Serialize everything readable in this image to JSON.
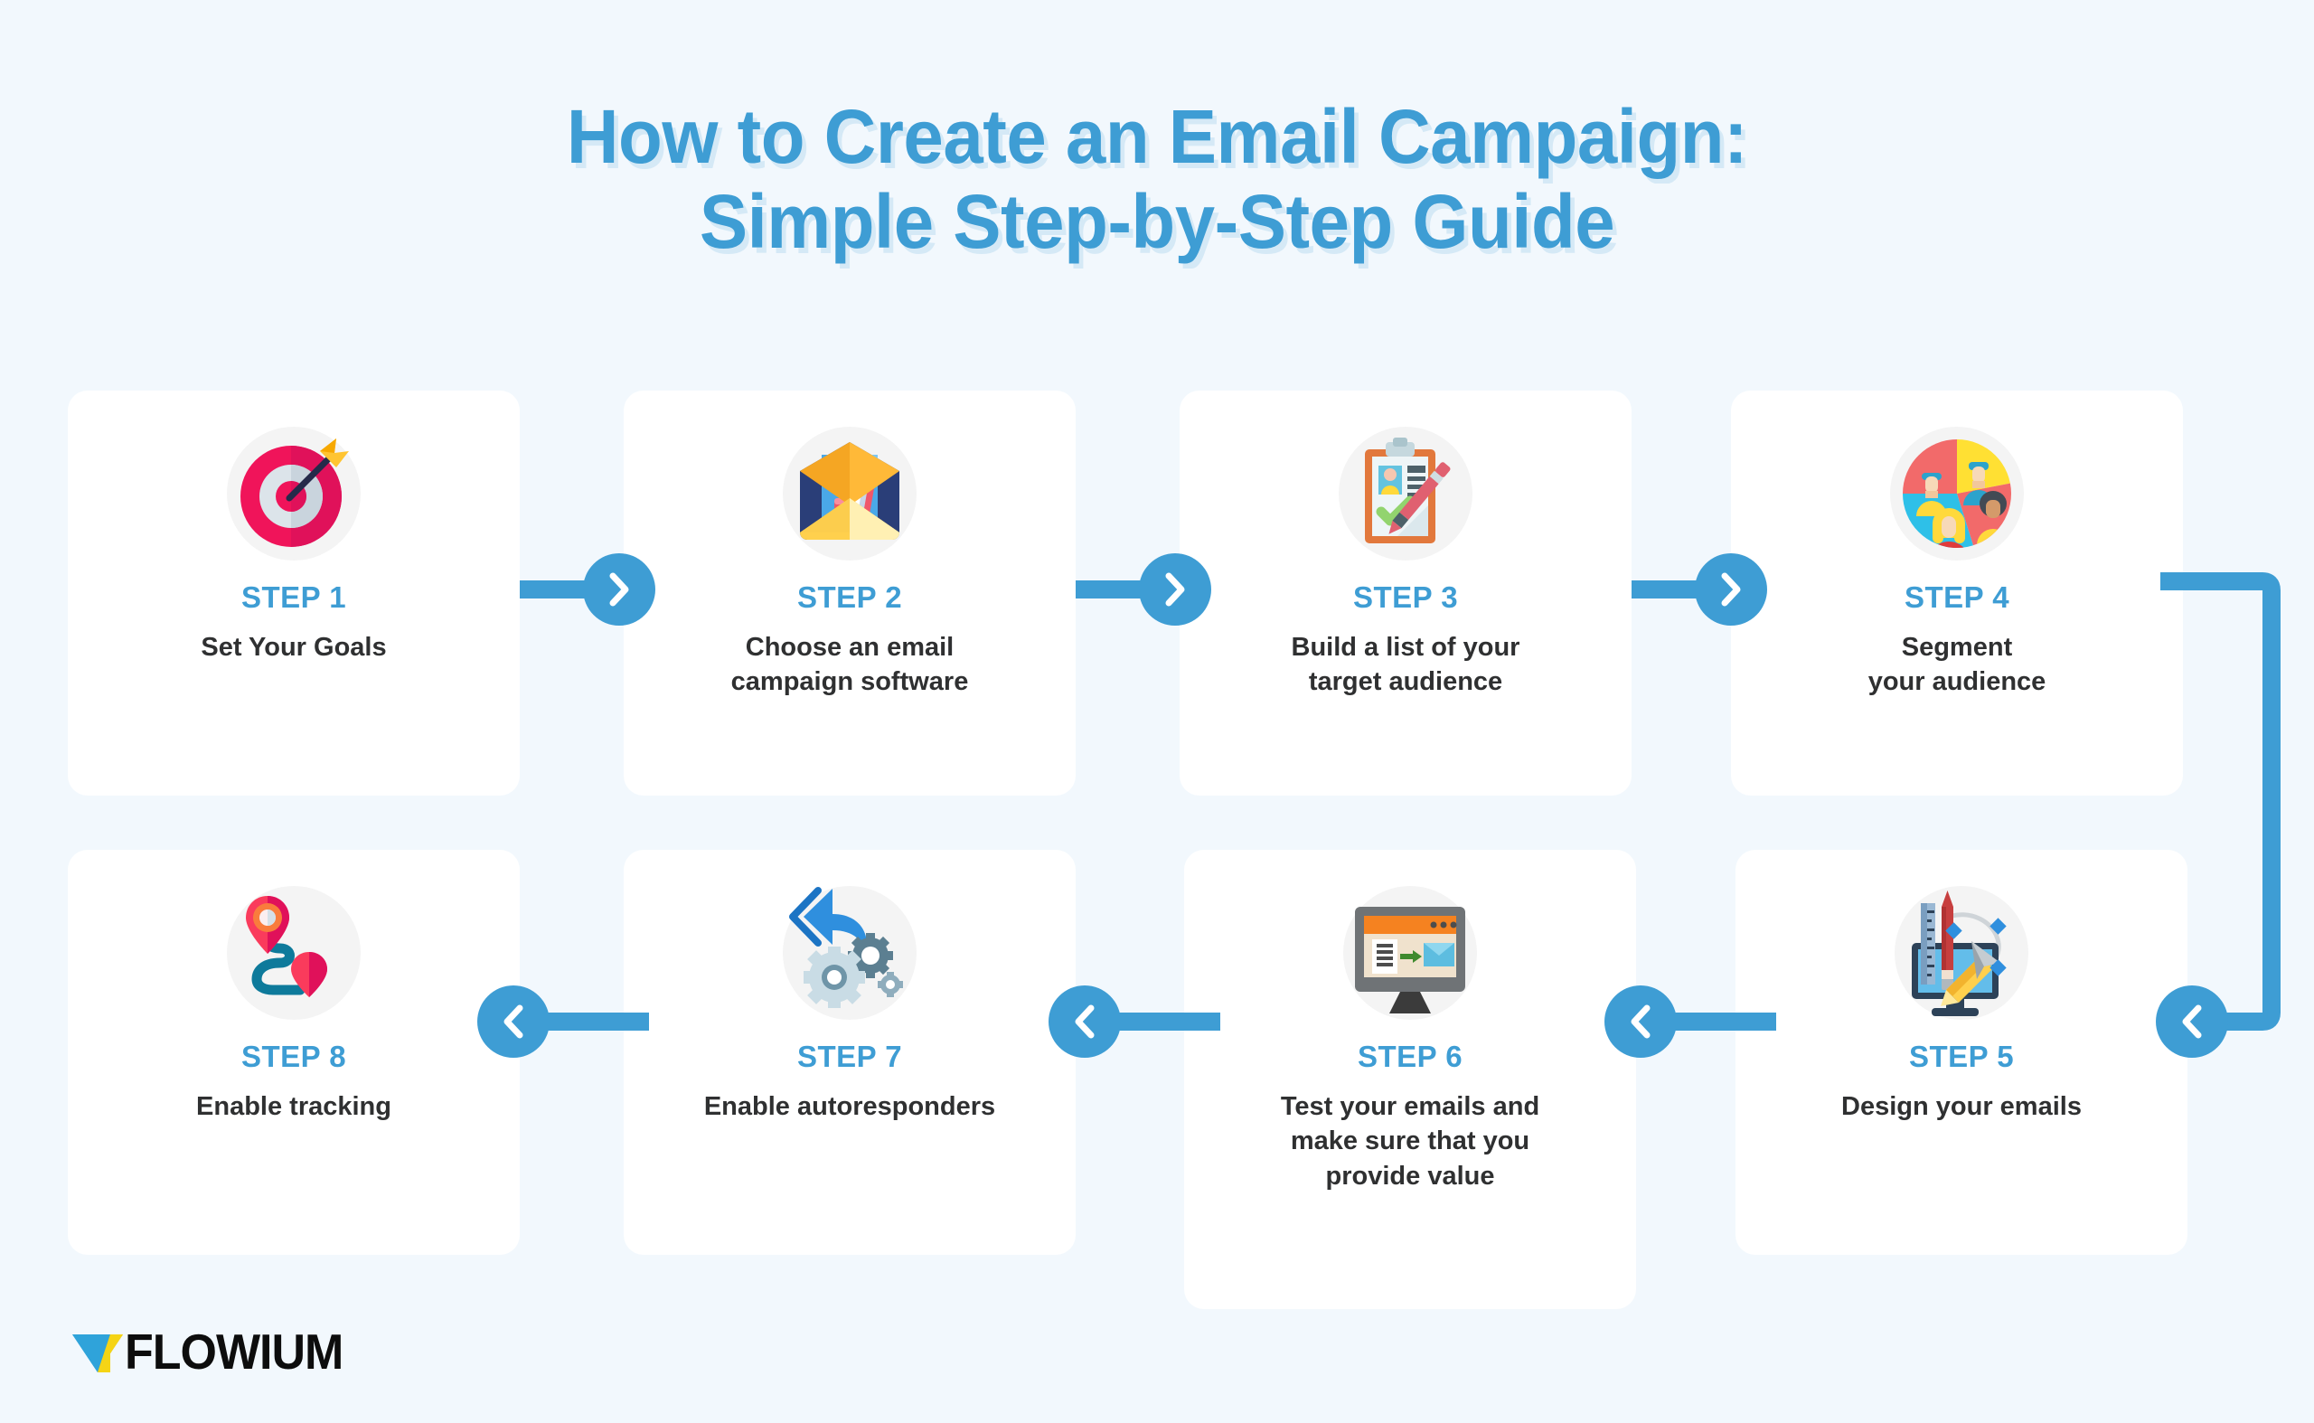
{
  "page": {
    "background_color": "#f2f8fd",
    "accent_color": "#3e9dd4",
    "card_color": "#ffffff",
    "text_color": "#2f3031"
  },
  "title": {
    "line1": "How to Create an Email Campaign:",
    "line2": "Simple Step-by-Step Guide"
  },
  "steps": [
    {
      "label": "STEP 1",
      "desc": "Set Your Goals",
      "icon": "target-dartboard-icon"
    },
    {
      "label": "STEP 2",
      "desc": "Choose an email\ncampaign software",
      "icon": "envelope-megaphone-icon"
    },
    {
      "label": "STEP 3",
      "desc": "Build a list of your\ntarget audience",
      "icon": "clipboard-profile-checkmark-icon"
    },
    {
      "label": "STEP 4",
      "desc": "Segment\nyour audience",
      "icon": "pie-chart-people-icon"
    },
    {
      "label": "STEP 5",
      "desc": "Design your emails",
      "icon": "monitor-design-tools-icon"
    },
    {
      "label": "STEP 6",
      "desc": "Test your emails and\nmake sure that you\nprovide value",
      "icon": "monitor-email-test-icon"
    },
    {
      "label": "STEP 7",
      "desc": "Enable autoresponders",
      "icon": "reply-arrow-gears-icon"
    },
    {
      "label": "STEP 8",
      "desc": "Enable tracking",
      "icon": "map-pins-route-icon"
    }
  ],
  "connectors": [
    {
      "name": "arrow-step1-to-step2",
      "direction": "right"
    },
    {
      "name": "arrow-step2-to-step3",
      "direction": "right"
    },
    {
      "name": "arrow-step3-to-step4",
      "direction": "right"
    },
    {
      "name": "arrow-step4-to-step5-wrap",
      "direction": "left"
    },
    {
      "name": "arrow-step5-to-step6",
      "direction": "left"
    },
    {
      "name": "arrow-step6-to-step7",
      "direction": "left"
    },
    {
      "name": "arrow-step7-to-step8",
      "direction": "left"
    }
  ],
  "logo": {
    "text": "FLOWIUM",
    "mark_color_blue": "#2fa3da",
    "mark_color_yellow": "#f5d415"
  }
}
